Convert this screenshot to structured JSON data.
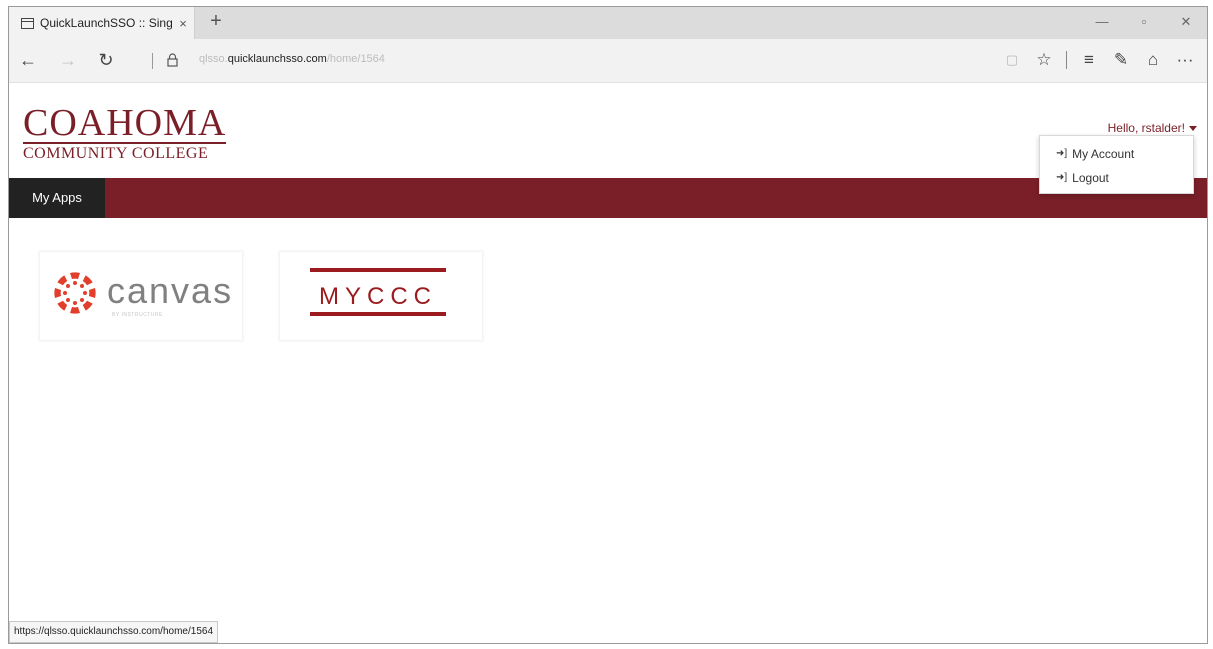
{
  "browser": {
    "tab_title": "QuickLaunchSSO :: Sing",
    "tab_close": "×",
    "new_tab": "+",
    "url_prefix": "qlsso.",
    "url_domain": "quicklaunchsso.com",
    "url_path": "/home/1564"
  },
  "header": {
    "logo_main": "COAHOMA",
    "logo_sub": "COMMUNITY COLLEGE",
    "greeting": "Hello, rstalder!"
  },
  "nav": {
    "my_apps": "My Apps"
  },
  "user_menu": {
    "items": [
      "My Account",
      "Logout"
    ]
  },
  "apps": {
    "canvas": {
      "label": "canvas",
      "tagline": "BY INSTRUCTURE"
    },
    "myccc": {
      "label": "MYCCC"
    }
  },
  "status_url": "https://qlsso.quicklaunchsso.com/home/1564",
  "colors": {
    "brand_maroon": "#7a1f27",
    "canvas_red": "#e13f2b",
    "myccc_red": "#9b1b1e"
  }
}
